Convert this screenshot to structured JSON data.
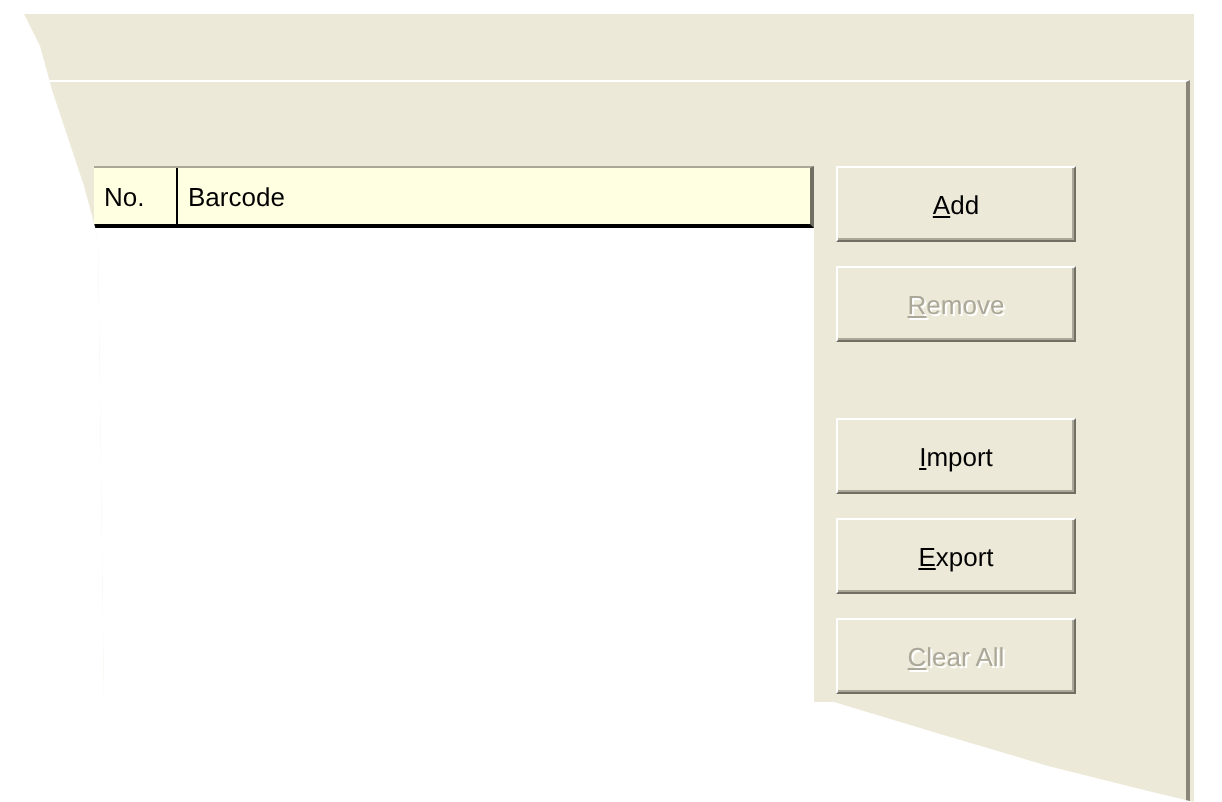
{
  "list": {
    "columns": [
      {
        "label": "No."
      },
      {
        "label": "Barcode"
      }
    ]
  },
  "button_groups": [
    {
      "buttons": [
        {
          "label": "Add",
          "disabled": false
        },
        {
          "label": "Remove",
          "disabled": true
        }
      ]
    },
    {
      "buttons": [
        {
          "label": "Import",
          "disabled": false
        },
        {
          "label": "Export",
          "disabled": false
        },
        {
          "label": "Clear All",
          "disabled": true
        }
      ]
    }
  ]
}
